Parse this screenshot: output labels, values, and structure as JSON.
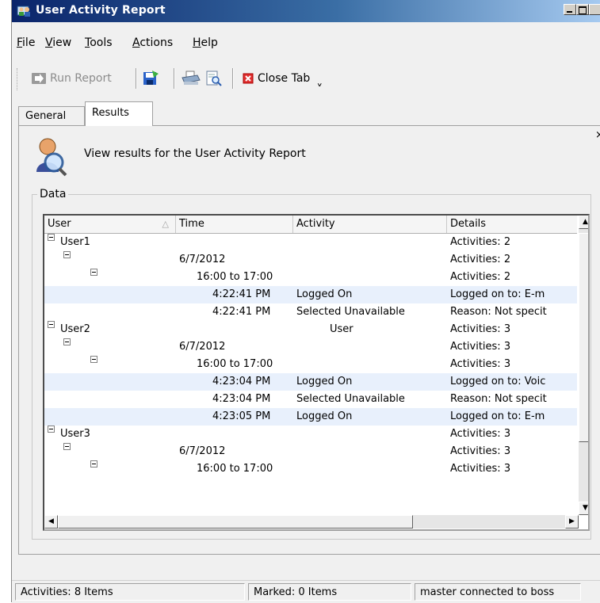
{
  "window": {
    "title": "User Activity Report",
    "title_icon": "report-people-icon"
  },
  "menu": [
    {
      "label": "File",
      "underline": "F",
      "rest": "ile"
    },
    {
      "label": "View",
      "underline": "V",
      "rest": "iew"
    },
    {
      "label": "Tools",
      "underline": "T",
      "rest": "ools"
    },
    {
      "label": "Actions",
      "underline": "A",
      "rest": "ctions"
    },
    {
      "label": "Help",
      "underline": "H",
      "rest": "elp"
    }
  ],
  "toolbar": {
    "run_report": "Run Report",
    "close_tab": "Close Tab",
    "dropdown": "ˬ"
  },
  "tabs": [
    {
      "label": "General",
      "active": false
    },
    {
      "label": "Results",
      "active": true
    }
  ],
  "panel": {
    "header_text": "View results for the User Activity Report",
    "close_glyph": "×",
    "group_label": "Data"
  },
  "table": {
    "columns": [
      "User",
      "Time",
      "Activity",
      "Details"
    ],
    "sort_glyph": "△",
    "rows": [
      {
        "level": 0,
        "expander": true,
        "user": "User1",
        "time": "",
        "activity": "",
        "details": "Activities: 2",
        "highlight": false
      },
      {
        "level": 1,
        "expander": true,
        "user": "",
        "time": "6/7/2012",
        "activity": "",
        "details": "Activities: 2",
        "highlight": false
      },
      {
        "level": 2,
        "expander": true,
        "user": "",
        "time": "16:00 to 17:00",
        "activity": "",
        "details": "Activities: 2",
        "highlight": false
      },
      {
        "level": 3,
        "expander": false,
        "user": "",
        "time": "4:22:41 PM",
        "activity": "Logged On",
        "details": "Logged on to: E-m",
        "highlight": true
      },
      {
        "level": 3,
        "expander": false,
        "user": "",
        "time": "4:22:41 PM",
        "activity": "Selected Unavailable",
        "details": "Reason: Not specit",
        "highlight": false
      },
      {
        "level": 0,
        "expander": true,
        "user": "User2",
        "time": "",
        "activity": "User",
        "details": "Activities: 3",
        "highlight": false
      },
      {
        "level": 1,
        "expander": true,
        "user": "",
        "time": "6/7/2012",
        "activity": "",
        "details": "Activities: 3",
        "highlight": false
      },
      {
        "level": 2,
        "expander": true,
        "user": "",
        "time": "16:00 to 17:00",
        "activity": "",
        "details": "Activities: 3",
        "highlight": false
      },
      {
        "level": 3,
        "expander": false,
        "user": "",
        "time": "4:23:04 PM",
        "activity": "Logged On",
        "details": "Logged on to: Voic",
        "highlight": true
      },
      {
        "level": 3,
        "expander": false,
        "user": "",
        "time": "4:23:04 PM",
        "activity": "Selected Unavailable",
        "details": "Reason: Not specit",
        "highlight": false
      },
      {
        "level": 3,
        "expander": false,
        "user": "",
        "time": "4:23:05 PM",
        "activity": "Logged On",
        "details": "Logged on to: E-m",
        "highlight": true
      },
      {
        "level": 0,
        "expander": true,
        "user": "User3",
        "time": "",
        "activity": "",
        "details": "Activities: 3",
        "highlight": false
      },
      {
        "level": 1,
        "expander": true,
        "user": "",
        "time": "6/7/2012",
        "activity": "",
        "details": "Activities: 3",
        "highlight": false
      },
      {
        "level": 2,
        "expander": true,
        "user": "",
        "time": "16:00 to 17:00",
        "activity": "",
        "details": "Activities: 3",
        "highlight": false
      }
    ]
  },
  "scrollbar": {
    "up": "▲",
    "down": "▼",
    "left": "◀",
    "right": "▶"
  },
  "status": {
    "activities": "Activities: 8 Items",
    "marked": "Marked: 0 Items",
    "connection": "master connected to boss"
  }
}
